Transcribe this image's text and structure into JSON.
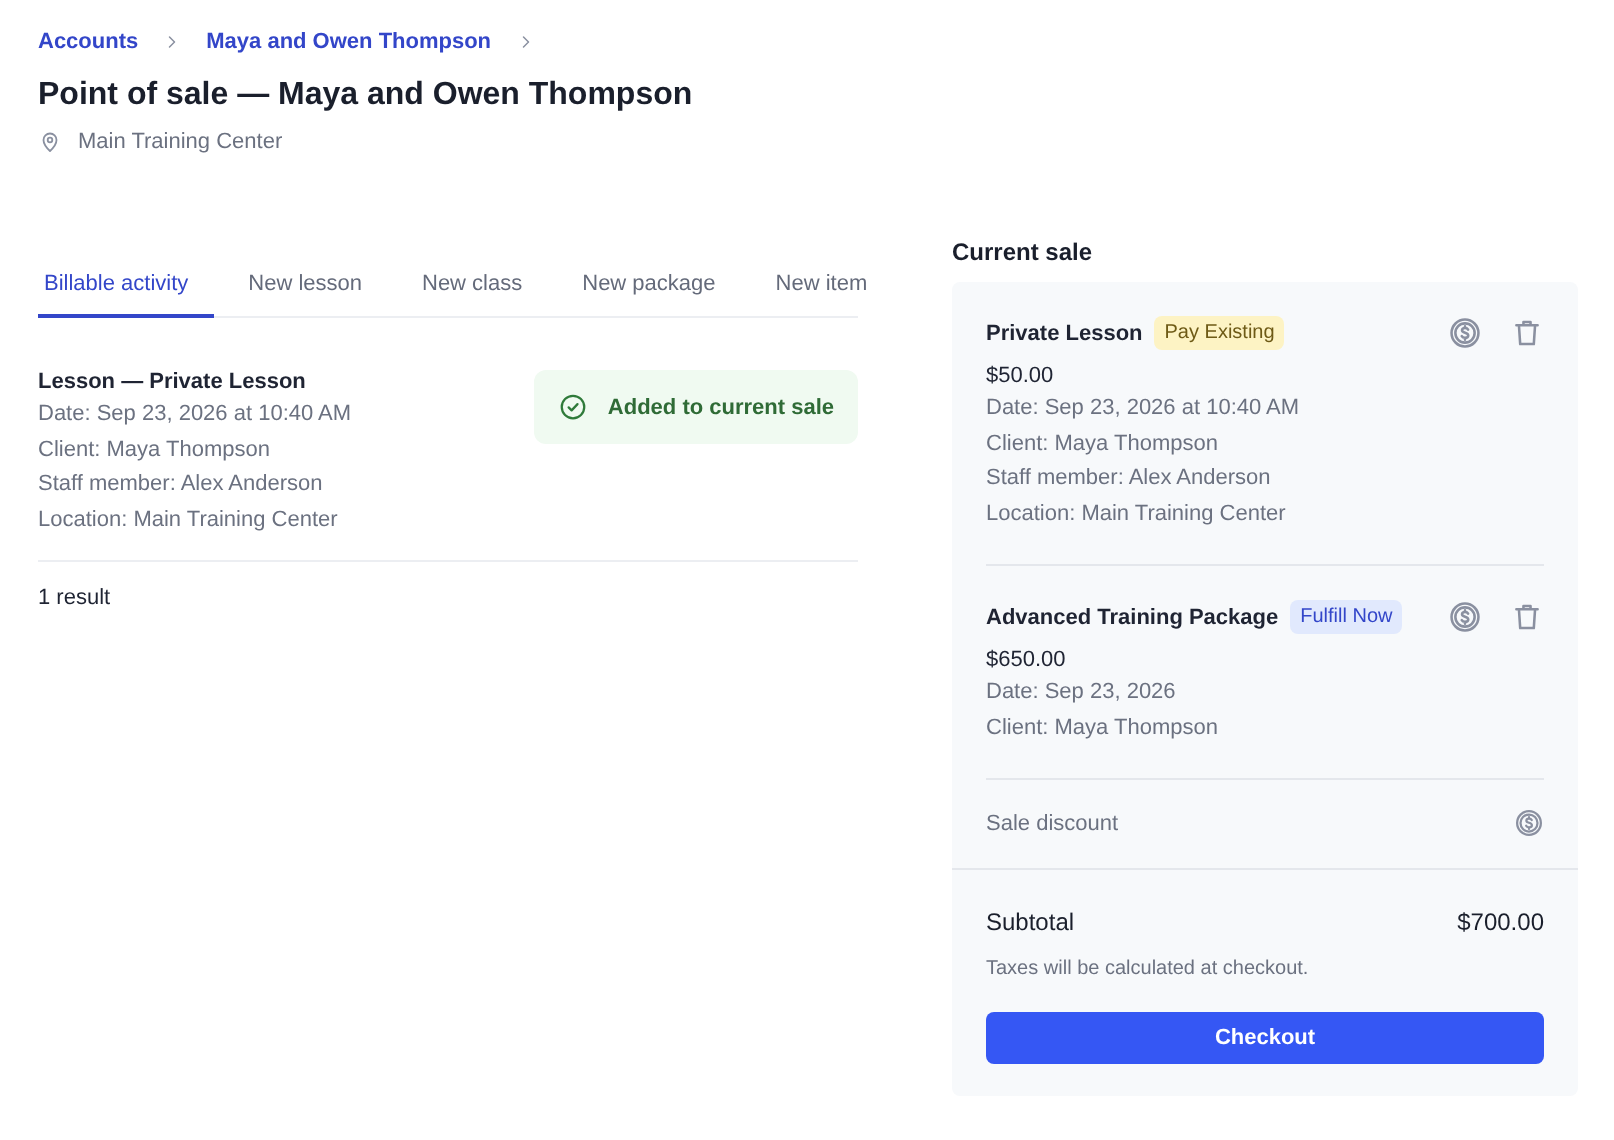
{
  "breadcrumbs": [
    "Accounts",
    "Maya and Owen Thompson"
  ],
  "title": "Point of sale — Maya and Owen Thompson",
  "location": "Main Training Center",
  "tabs": [
    {
      "label": "Billable activity",
      "selected": true
    },
    {
      "label": "New lesson",
      "selected": false
    },
    {
      "label": "New class",
      "selected": false
    },
    {
      "label": "New package",
      "selected": false
    },
    {
      "label": "New item",
      "selected": false
    }
  ],
  "activity": {
    "items": [
      {
        "title": "Lesson — Private Lesson",
        "details": [
          "Date: Sep 23, 2026 at 10:40 AM",
          "Client: Maya Thompson",
          "Staff member: Alex Anderson",
          "Location: Main Training Center"
        ],
        "status": "Added to current sale"
      }
    ],
    "result_count": "1 result"
  },
  "current_sale": {
    "heading": "Current sale",
    "items": [
      {
        "name": "Private Lesson",
        "badge": {
          "label": "Pay Existing",
          "kind": "warning"
        },
        "price": "$50.00",
        "details": [
          "Date: Sep 23, 2026 at 10:40 AM",
          "Client: Maya Thompson",
          "Staff member: Alex Anderson",
          "Location: Main Training Center"
        ]
      },
      {
        "name": "Advanced Training Package",
        "badge": {
          "label": "Fulfill Now",
          "kind": "info"
        },
        "price": "$650.00",
        "details": [
          "Date: Sep 23, 2026",
          "Client: Maya Thompson"
        ]
      }
    ],
    "discount_label": "Sale discount",
    "subtotal_label": "Subtotal",
    "subtotal": "$700.00",
    "tax_note": "Taxes will be calculated at checkout.",
    "checkout_button": "Checkout"
  }
}
